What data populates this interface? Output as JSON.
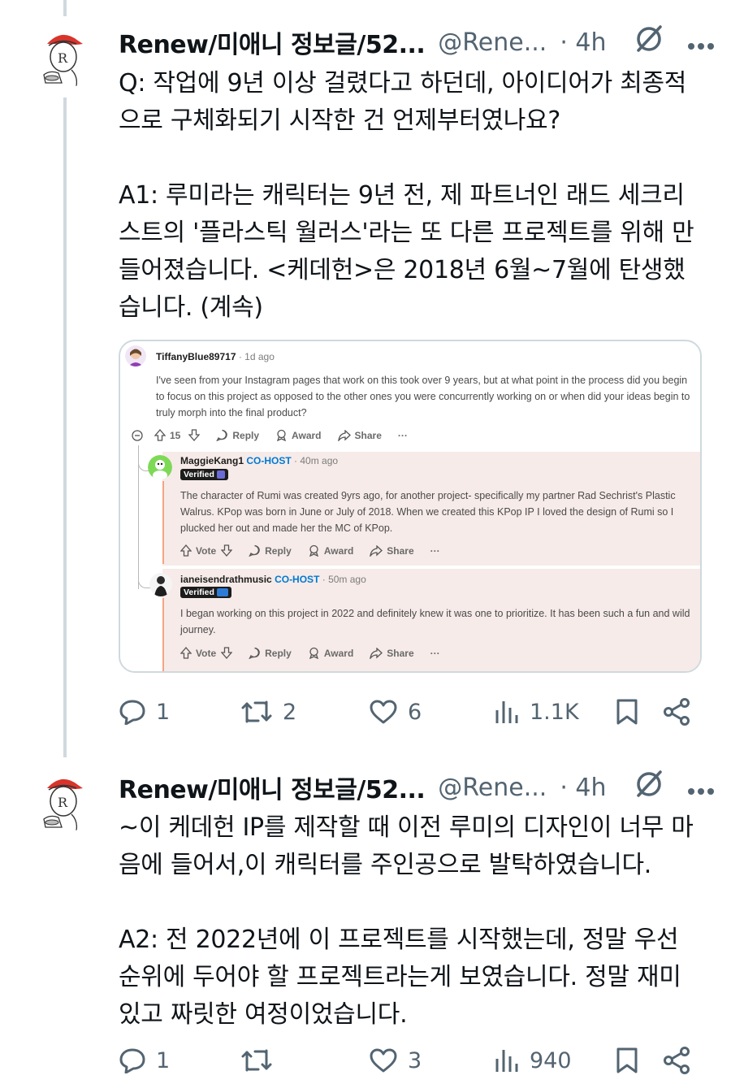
{
  "tweets": [
    {
      "name": "Renew/미애니 정보글/52...",
      "handle": "@Rene...",
      "time": "· 4h",
      "text": "Q: 작업에 9년 이상 걸렸다고 하던데, 아이디어가 최종적\n으로 구체화되기 시작한 건 언제부터였나요?\n\nA1: 루미라는 캐릭터는 9년 전, 제 파트너인 래드 세크리\n스트의 '플라스틱 월러스'라는 또 다른 프로젝트를 위해 만\n들어졌습니다. <케데헌>은 2018년 6월~7월에 탄생했\n습니다. (계속)",
      "replies": "1",
      "reposts": "2",
      "likes": "6",
      "views": "1.1K"
    },
    {
      "name": "Renew/미애니 정보글/52...",
      "handle": "@Rene...",
      "time": "· 4h",
      "text": "~이 케데헌 IP를 제작할 때 이전 루미의 디자인이 너무 마\n음에 들어서,이 캐릭터를 주인공으로 발탁하였습니다.\n\nA2: 전 2022년에 이 프로젝트를 시작했는데, 정말 우선\n순위에 두어야 할 프로젝트라는게 보였습니다. 정말 재미\n있고 짜릿한 여정이었습니다.",
      "replies": "1",
      "reposts": "",
      "likes": "3",
      "views": "940"
    }
  ],
  "embed": {
    "question": {
      "user": "TiffanyBlue89717",
      "ago": "· 1d ago",
      "text": "I've seen from your Instagram pages that work on this took over 9 years, but at what point in the process did you begin to focus on this project as opposed to the other ones you were concurrently working on or when did your ideas begin to truly morph into the final product?",
      "votes": "15",
      "reply": "Reply",
      "award": "Award",
      "share": "Share",
      "more": "···"
    },
    "answers": [
      {
        "user": "MaggieKang1",
        "role": "CO-HOST",
        "ago": "· 40m ago",
        "verified": "Verified",
        "text": "The character of Rumi was created 9yrs ago, for another project- specifically my partner Rad Sechrist's Plastic Walrus. KPop was born in June or July of 2018. When we created this KPop IP I loved the design of Rumi so I plucked her out and made her the MC of KPop.",
        "vote": "Vote",
        "reply": "Reply",
        "award": "Award",
        "share": "Share",
        "more": "···"
      },
      {
        "user": "ianeisendrathmusic",
        "role": "CO-HOST",
        "ago": "· 50m ago",
        "verified": "Verified",
        "text": "I began working on this project in 2022 and definitely knew it was one to prioritize. It has been such a fun and wild journey.",
        "vote": "Vote",
        "reply": "Reply",
        "award": "Award",
        "share": "Share",
        "more": "···"
      }
    ]
  },
  "icons": [
    "grok-slash-icon",
    "more-icon",
    "reply-icon",
    "repost-icon",
    "like-icon",
    "views-icon",
    "bookmark-icon",
    "share-icon"
  ],
  "colors": {
    "text": "#0f1419",
    "secondary": "#536471",
    "thread_line": "#cfd9de",
    "reddit_cohost": "#0079d3",
    "reddit_highlight": "#f6ebe8",
    "reddit_bar": "#f4a383"
  }
}
